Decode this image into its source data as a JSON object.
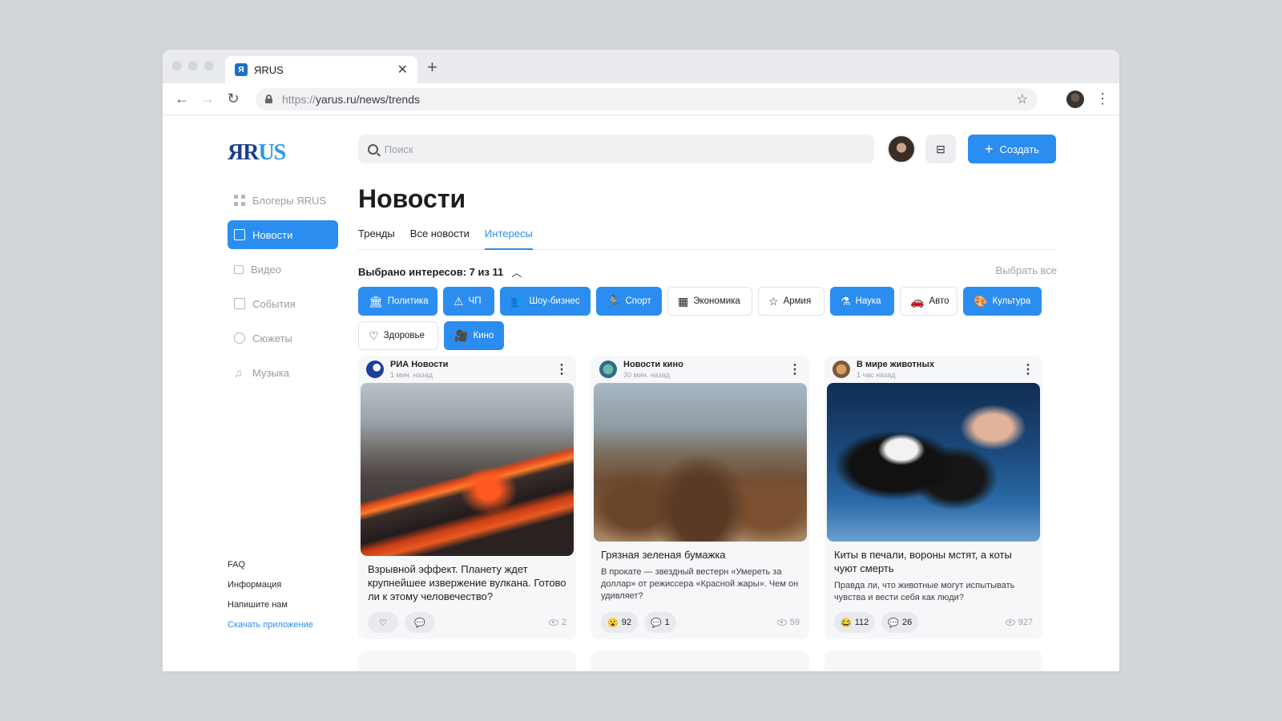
{
  "browser": {
    "tab_title": "ЯRUS",
    "tab_favicon": "Я",
    "url_protocol": "https://",
    "url_rest": "yarus.ru/news/trends"
  },
  "site": {
    "logo_part1": "ЯR",
    "logo_part2": "US",
    "search_placeholder": "Поиск",
    "create_label": "Создать"
  },
  "sidebar": {
    "items": [
      {
        "label": "Блогеры ЯRUS",
        "icon": "grid-icon"
      },
      {
        "label": "Новости",
        "icon": "document-icon"
      },
      {
        "label": "Видео",
        "icon": "video-icon"
      },
      {
        "label": "События",
        "icon": "calendar-icon"
      },
      {
        "label": "Сюжеты",
        "icon": "play-circle-icon"
      },
      {
        "label": "Музыка",
        "icon": "music-note-icon"
      }
    ],
    "footer": [
      "FAQ",
      "Информация",
      "Напишите нам"
    ],
    "download_app": "Скачать приложение"
  },
  "main": {
    "title": "Новости",
    "tabs": [
      "Тренды",
      "Все новости",
      "Интересы"
    ],
    "active_tab": 2,
    "selected_label": "Выбрано интересов: 7 из 11",
    "select_all": "Выбрать все",
    "accent_color": "#2b8def",
    "chips": [
      {
        "label": "Политика",
        "icon": "capitol-icon",
        "selected": true
      },
      {
        "label": "ЧП",
        "icon": "warning-icon",
        "selected": true
      },
      {
        "label": "Шоу-бизнес",
        "icon": "people-icon",
        "selected": true
      },
      {
        "label": "Спорт",
        "icon": "runner-icon",
        "selected": true
      },
      {
        "label": "Экономика",
        "icon": "cash-register-icon",
        "selected": false
      },
      {
        "label": "Армия",
        "icon": "star-icon",
        "selected": false
      },
      {
        "label": "Наука",
        "icon": "flask-icon",
        "selected": true
      },
      {
        "label": "Авто",
        "icon": "car-icon",
        "selected": false
      },
      {
        "label": "Культура",
        "icon": "palette-icon",
        "selected": true
      },
      {
        "label": "Здоровье",
        "icon": "heart-icon",
        "selected": false
      },
      {
        "label": "Кино",
        "icon": "camera-icon",
        "selected": true
      }
    ],
    "cards": [
      {
        "source": "РИА Новости",
        "time": "1 мин. назад",
        "title": "Взрывной эффект. Планету ждет крупнейшее извержение вулкана. Готово ли к этому человечество?",
        "desc": "",
        "reaction": "",
        "comments": "",
        "views": "2"
      },
      {
        "source": "Новости кино",
        "time": "30 мин. назад",
        "title": "Грязная зеленая бумажка",
        "desc": "В прокате — звездный вестерн «Умереть за доллар» от режиссера «Красной жары». Чем он удивляет?",
        "reaction": "92",
        "comments": "1",
        "views": "59"
      },
      {
        "source": "В мире животных",
        "time": "1 час назад",
        "title": "Киты в печали, вороны мстят, а коты чуют смерть",
        "desc": "Правда ли, что животные могут испытывать чувства и вести себя как люди?",
        "reaction": "112",
        "comments": "26",
        "views": "927"
      }
    ]
  }
}
